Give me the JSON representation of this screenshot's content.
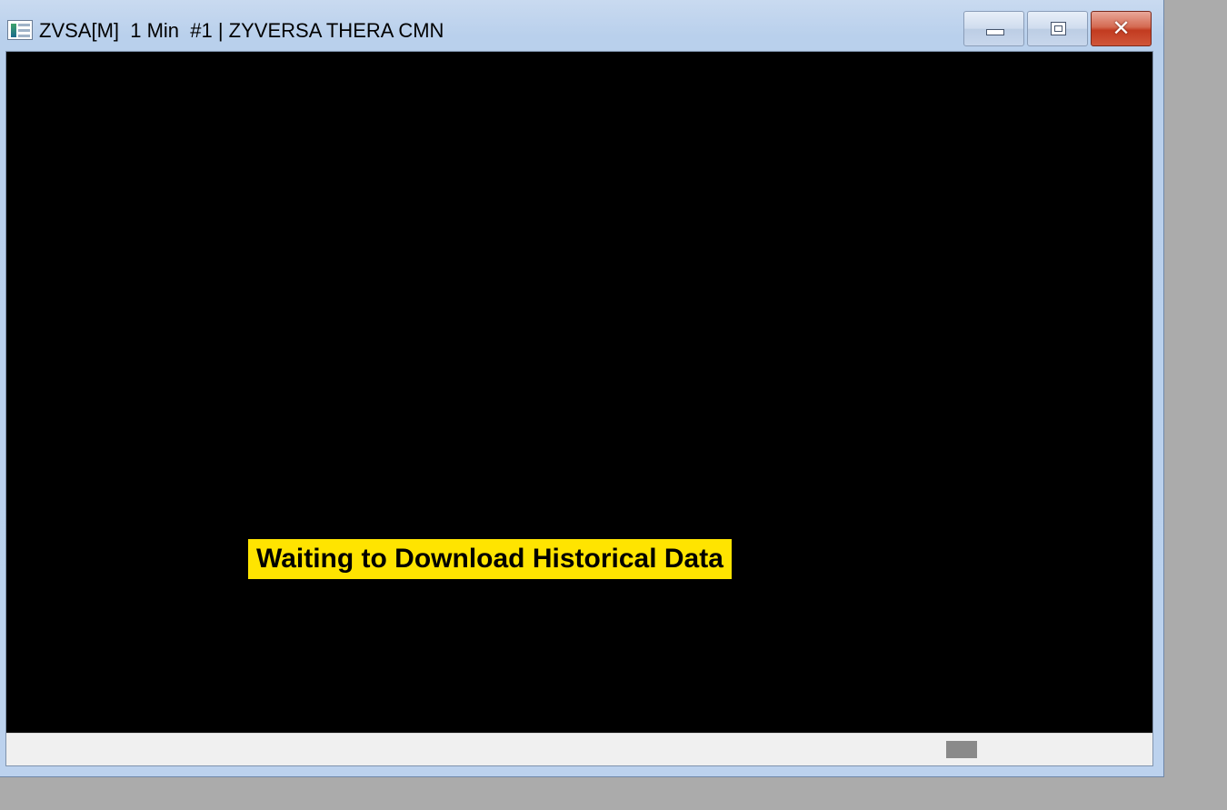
{
  "window": {
    "title": "ZVSA[M]  1 Min  #1 | ZYVERSA THERA CMN",
    "icon": "chart-window-icon",
    "buttons": {
      "minimize_icon": "minimize-icon",
      "maximize_icon": "maximize-icon",
      "close_glyph": "✕"
    }
  },
  "chart": {
    "message": "Waiting to Download Historical Data",
    "background_color": "#000000",
    "message_background_color": "#ffe400"
  },
  "scrollbar": {
    "orientation": "horizontal"
  }
}
